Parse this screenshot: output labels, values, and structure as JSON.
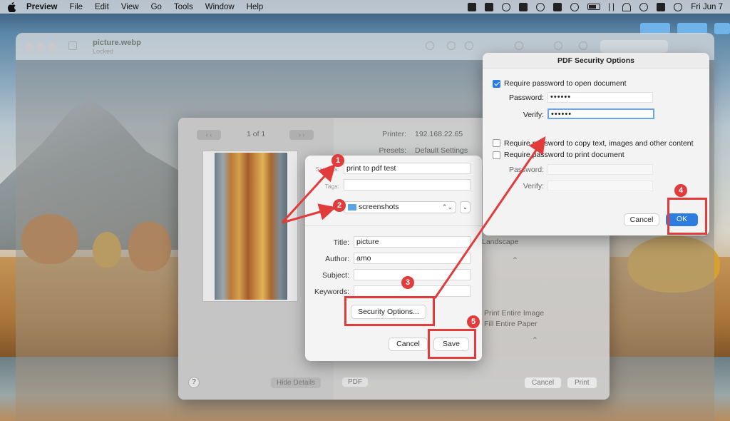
{
  "menubar": {
    "app": "Preview",
    "items": [
      "File",
      "Edit",
      "View",
      "Go",
      "Tools",
      "Window",
      "Help"
    ],
    "clock": "Fri Jun 7"
  },
  "preview_window": {
    "title": "picture.webp",
    "subtitle": "Locked"
  },
  "print_dialog": {
    "page_count": "1 of 1",
    "printer_label": "Printer:",
    "printer_value": "192.168.22.65",
    "presets_label": "Presets:",
    "presets_value": "Default Settings",
    "orientation": "Landscape",
    "print_entire_image": "Print Entire Image",
    "fill_entire_paper": "Fill Entire Paper",
    "help": "?",
    "hide_details": "Hide Details",
    "pdf": "PDF",
    "cancel": "Cancel",
    "print": "Print"
  },
  "save_dialog": {
    "save_as_label": "Save As:",
    "save_as_value": "print to pdf test",
    "tags_label": "Tags:",
    "where_label": "Where:",
    "where_value": "screenshots",
    "title_label": "Title:",
    "title_value": "picture",
    "author_label": "Author:",
    "author_value": "amo",
    "subject_label": "Subject:",
    "subject_value": "",
    "keywords_label": "Keywords:",
    "keywords_value": "",
    "security_options": "Security Options...",
    "cancel": "Cancel",
    "save": "Save"
  },
  "security_dialog": {
    "title": "PDF Security Options",
    "require_open": "Require password to open document",
    "require_open_checked": true,
    "password_label": "Password:",
    "password_value": "••••••",
    "verify_label": "Verify:",
    "verify_value": "••••••",
    "require_copy": "Require password to copy text, images and other content",
    "require_copy_checked": false,
    "require_print": "Require password to print document",
    "require_print_checked": false,
    "password2_label": "Password:",
    "verify2_label": "Verify:",
    "cancel": "Cancel",
    "ok": "OK"
  },
  "annotations": {
    "steps": [
      "1",
      "2",
      "3",
      "4",
      "5"
    ],
    "color": "#e23b3b"
  },
  "colors": {
    "accent": "#2d7de0",
    "folder": "#5aa3e6"
  }
}
